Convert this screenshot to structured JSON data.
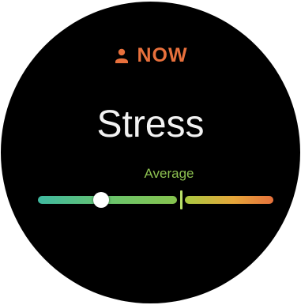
{
  "header": {
    "icon": "person-icon",
    "label": "NOW",
    "color": "#e8703c"
  },
  "title": "Stress",
  "gauge": {
    "level_label": "Average",
    "level_label_color": "#8cc050",
    "current_value": 0.27,
    "average_marker_value": 0.61,
    "gradient_colors": [
      "#3fb9a0",
      "#86c34e",
      "#e6a63a",
      "#e6723c"
    ]
  }
}
